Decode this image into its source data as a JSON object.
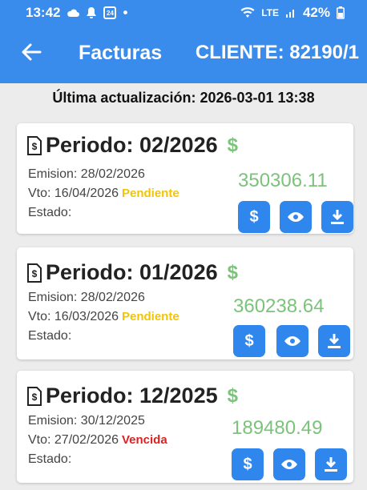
{
  "status_bar": {
    "time": "13:42",
    "dot": "•",
    "calendar_day": "24",
    "net_label": "LTE",
    "battery": "42%"
  },
  "header": {
    "title": "Facturas",
    "client": "CLIENTE: 82190/1"
  },
  "updated": "Última actualización: 2026-03-01 13:38",
  "currency_symbol": "$",
  "invoices": [
    {
      "period": "Periodo: 02/2026",
      "emision": "Emision: 28/02/2026",
      "vto": "Vto: 16/04/2026",
      "status": "Pendiente",
      "estado": "Estado:",
      "amount": "350306.11"
    },
    {
      "period": "Periodo: 01/2026",
      "emision": "Emision: 28/02/2026",
      "vto": "Vto: 16/03/2026",
      "status": "Pendiente",
      "estado": "Estado:",
      "amount": "360238.64"
    },
    {
      "period": "Periodo: 12/2025",
      "emision": "Emision: 30/12/2025",
      "vto": "Vto: 27/02/2026",
      "status": "Vencida",
      "estado": "Estado:",
      "amount": "189480.49"
    }
  ],
  "colors": {
    "primary": "#3a8cec",
    "button": "#2f86ec",
    "amount": "#7bc27b",
    "pending": "#f3c400",
    "overdue": "#e02020"
  }
}
